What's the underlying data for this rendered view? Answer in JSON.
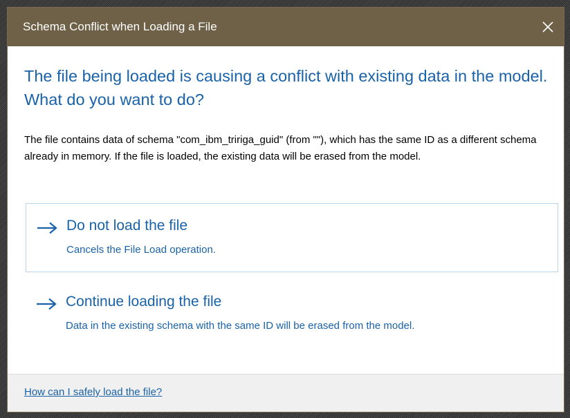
{
  "dialog": {
    "title": "Schema Conflict when Loading a File",
    "close_icon": "close-icon",
    "headline": "The file being loaded is causing a conflict with existing data in the model. What do you want to do?",
    "description": "The file contains data of schema \"com_ibm_tririga_guid\" (from \"\"), which has the same ID as a different schema already in memory. If the file is loaded, the existing data will be erased from the model.",
    "options": [
      {
        "icon": "arrow-right-icon",
        "title": "Do not load the file",
        "description": "Cancels the File Load operation."
      },
      {
        "icon": "arrow-right-icon",
        "title": "Continue loading the file",
        "description": "Data in the existing schema with the same ID will be erased from the model."
      }
    ],
    "help_link": "How can I safely load the file?"
  },
  "colors": {
    "titlebar": "#6e6147",
    "accent": "#1a62a8",
    "option_border": "#b9d4ec",
    "footer": "#f0f0f0"
  }
}
